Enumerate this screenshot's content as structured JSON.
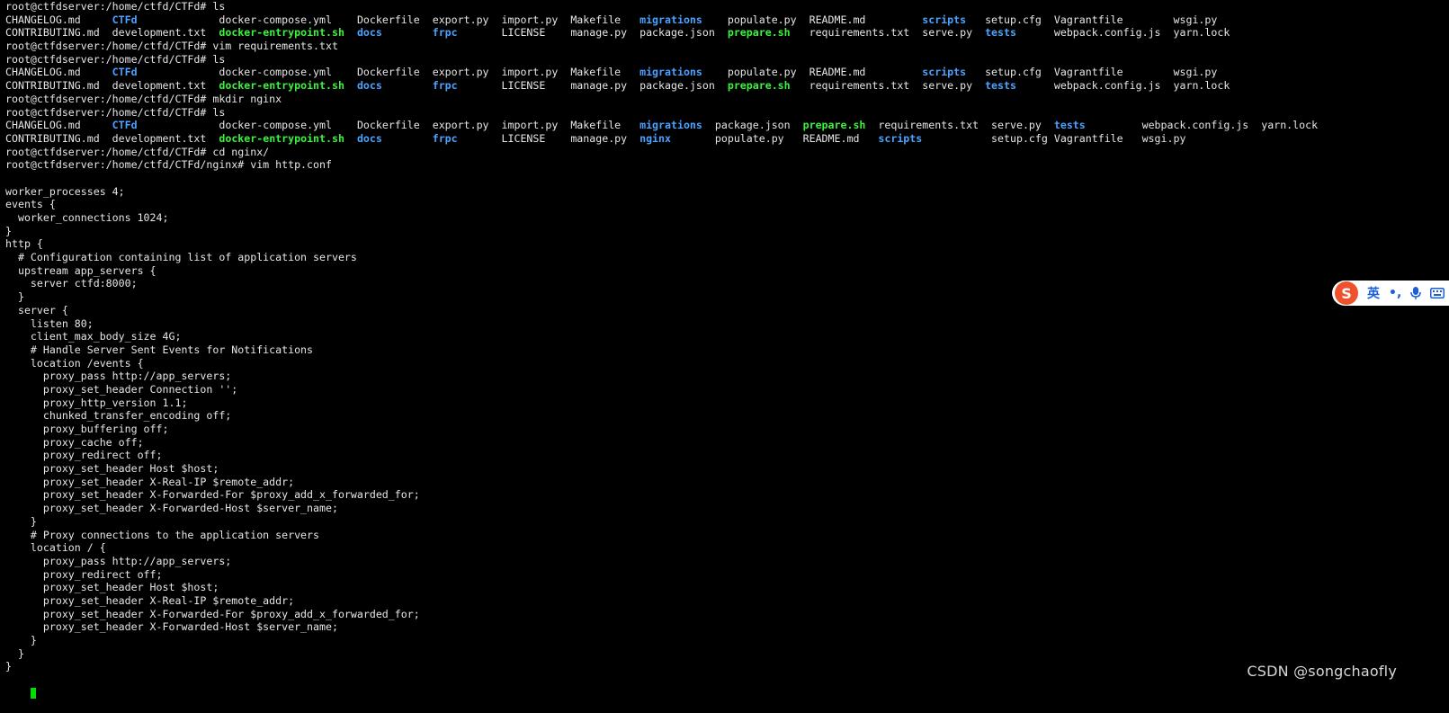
{
  "lines": [
    {
      "cells": [
        {
          "text": "root@ctfdserver:/home/ctfd/CTFd# ls",
          "col": 0,
          "type": "plain"
        }
      ]
    },
    {
      "cells": [
        {
          "text": "CHANGELOG.md",
          "col": 0,
          "type": "plain"
        },
        {
          "text": "CTFd",
          "col": 17,
          "type": "dir"
        },
        {
          "text": "docker-compose.yml",
          "col": 34,
          "type": "plain"
        },
        {
          "text": "Dockerfile",
          "col": 56,
          "type": "plain"
        },
        {
          "text": "export.py",
          "col": 68,
          "type": "plain"
        },
        {
          "text": "import.py",
          "col": 79,
          "type": "plain"
        },
        {
          "text": "Makefile",
          "col": 90,
          "type": "plain"
        },
        {
          "text": "migrations",
          "col": 101,
          "type": "dir"
        },
        {
          "text": "populate.py",
          "col": 115,
          "type": "plain"
        },
        {
          "text": "README.md",
          "col": 128,
          "type": "plain"
        },
        {
          "text": "scripts",
          "col": 146,
          "type": "dir"
        },
        {
          "text": "setup.cfg",
          "col": 156,
          "type": "plain"
        },
        {
          "text": "Vagrantfile",
          "col": 167,
          "type": "plain"
        },
        {
          "text": "wsgi.py",
          "col": 186,
          "type": "plain"
        }
      ]
    },
    {
      "cells": [
        {
          "text": "CONTRIBUTING.md",
          "col": 0,
          "type": "plain"
        },
        {
          "text": "development.txt",
          "col": 17,
          "type": "plain"
        },
        {
          "text": "docker-entrypoint.sh",
          "col": 34,
          "type": "exec"
        },
        {
          "text": "docs",
          "col": 56,
          "type": "dir"
        },
        {
          "text": "frpc",
          "col": 68,
          "type": "dir"
        },
        {
          "text": "LICENSE",
          "col": 79,
          "type": "plain"
        },
        {
          "text": "manage.py",
          "col": 90,
          "type": "plain"
        },
        {
          "text": "package.json",
          "col": 101,
          "type": "plain"
        },
        {
          "text": "prepare.sh",
          "col": 115,
          "type": "exec"
        },
        {
          "text": "requirements.txt",
          "col": 128,
          "type": "plain"
        },
        {
          "text": "serve.py",
          "col": 146,
          "type": "plain"
        },
        {
          "text": "tests",
          "col": 156,
          "type": "dir"
        },
        {
          "text": "webpack.config.js",
          "col": 167,
          "type": "plain"
        },
        {
          "text": "yarn.lock",
          "col": 186,
          "type": "plain"
        }
      ]
    },
    {
      "cells": [
        {
          "text": "root@ctfdserver:/home/ctfd/CTFd# vim requirements.txt",
          "col": 0,
          "type": "plain"
        }
      ]
    },
    {
      "cells": [
        {
          "text": "root@ctfdserver:/home/ctfd/CTFd# ls",
          "col": 0,
          "type": "plain"
        }
      ]
    },
    {
      "cells": [
        {
          "text": "CHANGELOG.md",
          "col": 0,
          "type": "plain"
        },
        {
          "text": "CTFd",
          "col": 17,
          "type": "dir"
        },
        {
          "text": "docker-compose.yml",
          "col": 34,
          "type": "plain"
        },
        {
          "text": "Dockerfile",
          "col": 56,
          "type": "plain"
        },
        {
          "text": "export.py",
          "col": 68,
          "type": "plain"
        },
        {
          "text": "import.py",
          "col": 79,
          "type": "plain"
        },
        {
          "text": "Makefile",
          "col": 90,
          "type": "plain"
        },
        {
          "text": "migrations",
          "col": 101,
          "type": "dir"
        },
        {
          "text": "populate.py",
          "col": 115,
          "type": "plain"
        },
        {
          "text": "README.md",
          "col": 128,
          "type": "plain"
        },
        {
          "text": "scripts",
          "col": 146,
          "type": "dir"
        },
        {
          "text": "setup.cfg",
          "col": 156,
          "type": "plain"
        },
        {
          "text": "Vagrantfile",
          "col": 167,
          "type": "plain"
        },
        {
          "text": "wsgi.py",
          "col": 186,
          "type": "plain"
        }
      ]
    },
    {
      "cells": [
        {
          "text": "CONTRIBUTING.md",
          "col": 0,
          "type": "plain"
        },
        {
          "text": "development.txt",
          "col": 17,
          "type": "plain"
        },
        {
          "text": "docker-entrypoint.sh",
          "col": 34,
          "type": "exec"
        },
        {
          "text": "docs",
          "col": 56,
          "type": "dir"
        },
        {
          "text": "frpc",
          "col": 68,
          "type": "dir"
        },
        {
          "text": "LICENSE",
          "col": 79,
          "type": "plain"
        },
        {
          "text": "manage.py",
          "col": 90,
          "type": "plain"
        },
        {
          "text": "package.json",
          "col": 101,
          "type": "plain"
        },
        {
          "text": "prepare.sh",
          "col": 115,
          "type": "exec"
        },
        {
          "text": "requirements.txt",
          "col": 128,
          "type": "plain"
        },
        {
          "text": "serve.py",
          "col": 146,
          "type": "plain"
        },
        {
          "text": "tests",
          "col": 156,
          "type": "dir"
        },
        {
          "text": "webpack.config.js",
          "col": 167,
          "type": "plain"
        },
        {
          "text": "yarn.lock",
          "col": 186,
          "type": "plain"
        }
      ]
    },
    {
      "cells": [
        {
          "text": "root@ctfdserver:/home/ctfd/CTFd# mkdir nginx",
          "col": 0,
          "type": "plain"
        }
      ]
    },
    {
      "cells": [
        {
          "text": "root@ctfdserver:/home/ctfd/CTFd# ls",
          "col": 0,
          "type": "plain"
        }
      ]
    },
    {
      "cells": [
        {
          "text": "CHANGELOG.md",
          "col": 0,
          "type": "plain"
        },
        {
          "text": "CTFd",
          "col": 17,
          "type": "dir"
        },
        {
          "text": "docker-compose.yml",
          "col": 34,
          "type": "plain"
        },
        {
          "text": "Dockerfile",
          "col": 56,
          "type": "plain"
        },
        {
          "text": "export.py",
          "col": 68,
          "type": "plain"
        },
        {
          "text": "import.py",
          "col": 79,
          "type": "plain"
        },
        {
          "text": "Makefile",
          "col": 90,
          "type": "plain"
        },
        {
          "text": "migrations",
          "col": 101,
          "type": "dir"
        },
        {
          "text": "package.json",
          "col": 113,
          "type": "plain"
        },
        {
          "text": "prepare.sh",
          "col": 127,
          "type": "exec"
        },
        {
          "text": "requirements.txt",
          "col": 139,
          "type": "plain"
        },
        {
          "text": "serve.py",
          "col": 157,
          "type": "plain"
        },
        {
          "text": "tests",
          "col": 167,
          "type": "dir"
        },
        {
          "text": "webpack.config.js",
          "col": 181,
          "type": "plain"
        },
        {
          "text": "yarn.lock",
          "col": 200,
          "type": "plain"
        }
      ]
    },
    {
      "cells": [
        {
          "text": "CONTRIBUTING.md",
          "col": 0,
          "type": "plain"
        },
        {
          "text": "development.txt",
          "col": 17,
          "type": "plain"
        },
        {
          "text": "docker-entrypoint.sh",
          "col": 34,
          "type": "exec"
        },
        {
          "text": "docs",
          "col": 56,
          "type": "dir"
        },
        {
          "text": "frpc",
          "col": 68,
          "type": "dir"
        },
        {
          "text": "LICENSE",
          "col": 79,
          "type": "plain"
        },
        {
          "text": "manage.py",
          "col": 90,
          "type": "plain"
        },
        {
          "text": "nginx",
          "col": 101,
          "type": "dir"
        },
        {
          "text": "populate.py",
          "col": 113,
          "type": "plain"
        },
        {
          "text": "README.md",
          "col": 127,
          "type": "plain"
        },
        {
          "text": "scripts",
          "col": 139,
          "type": "dir"
        },
        {
          "text": "setup.cfg",
          "col": 157,
          "type": "plain"
        },
        {
          "text": "Vagrantfile",
          "col": 167,
          "type": "plain"
        },
        {
          "text": "wsgi.py",
          "col": 181,
          "type": "plain"
        }
      ]
    },
    {
      "cells": [
        {
          "text": "root@ctfdserver:/home/ctfd/CTFd# cd nginx/",
          "col": 0,
          "type": "plain"
        }
      ]
    },
    {
      "cells": [
        {
          "text": "root@ctfdserver:/home/ctfd/CTFd/nginx# vim http.conf",
          "col": 0,
          "type": "plain"
        }
      ]
    },
    {
      "cells": [
        {
          "text": "",
          "col": 0,
          "type": "plain"
        }
      ]
    },
    {
      "cells": [
        {
          "text": "worker_processes 4;",
          "col": 0,
          "type": "plain"
        }
      ]
    },
    {
      "cells": [
        {
          "text": "events {",
          "col": 0,
          "type": "plain"
        }
      ]
    },
    {
      "cells": [
        {
          "text": "  worker_connections 1024;",
          "col": 0,
          "type": "plain"
        }
      ]
    },
    {
      "cells": [
        {
          "text": "}",
          "col": 0,
          "type": "plain"
        }
      ]
    },
    {
      "cells": [
        {
          "text": "http {",
          "col": 0,
          "type": "plain"
        }
      ]
    },
    {
      "cells": [
        {
          "text": "  # Configuration containing list of application servers",
          "col": 0,
          "type": "plain"
        }
      ]
    },
    {
      "cells": [
        {
          "text": "  upstream app_servers {",
          "col": 0,
          "type": "plain"
        }
      ]
    },
    {
      "cells": [
        {
          "text": "    server ctfd:8000;",
          "col": 0,
          "type": "plain"
        }
      ]
    },
    {
      "cells": [
        {
          "text": "  }",
          "col": 0,
          "type": "plain"
        }
      ]
    },
    {
      "cells": [
        {
          "text": "  server {",
          "col": 0,
          "type": "plain"
        }
      ]
    },
    {
      "cells": [
        {
          "text": "    listen 80;",
          "col": 0,
          "type": "plain"
        }
      ]
    },
    {
      "cells": [
        {
          "text": "    client_max_body_size 4G;",
          "col": 0,
          "type": "plain"
        }
      ]
    },
    {
      "cells": [
        {
          "text": "    # Handle Server Sent Events for Notifications",
          "col": 0,
          "type": "plain"
        }
      ]
    },
    {
      "cells": [
        {
          "text": "    location /events {",
          "col": 0,
          "type": "plain"
        }
      ]
    },
    {
      "cells": [
        {
          "text": "      proxy_pass http://app_servers;",
          "col": 0,
          "type": "plain"
        }
      ]
    },
    {
      "cells": [
        {
          "text": "      proxy_set_header Connection '';",
          "col": 0,
          "type": "plain"
        }
      ]
    },
    {
      "cells": [
        {
          "text": "      proxy_http_version 1.1;",
          "col": 0,
          "type": "plain"
        }
      ]
    },
    {
      "cells": [
        {
          "text": "      chunked_transfer_encoding off;",
          "col": 0,
          "type": "plain"
        }
      ]
    },
    {
      "cells": [
        {
          "text": "      proxy_buffering off;",
          "col": 0,
          "type": "plain"
        }
      ]
    },
    {
      "cells": [
        {
          "text": "      proxy_cache off;",
          "col": 0,
          "type": "plain"
        }
      ]
    },
    {
      "cells": [
        {
          "text": "      proxy_redirect off;",
          "col": 0,
          "type": "plain"
        }
      ]
    },
    {
      "cells": [
        {
          "text": "      proxy_set_header Host $host;",
          "col": 0,
          "type": "plain"
        }
      ]
    },
    {
      "cells": [
        {
          "text": "      proxy_set_header X-Real-IP $remote_addr;",
          "col": 0,
          "type": "plain"
        }
      ]
    },
    {
      "cells": [
        {
          "text": "      proxy_set_header X-Forwarded-For $proxy_add_x_forwarded_for;",
          "col": 0,
          "type": "plain"
        }
      ]
    },
    {
      "cells": [
        {
          "text": "      proxy_set_header X-Forwarded-Host $server_name;",
          "col": 0,
          "type": "plain"
        }
      ]
    },
    {
      "cells": [
        {
          "text": "    }",
          "col": 0,
          "type": "plain"
        }
      ]
    },
    {
      "cells": [
        {
          "text": "    # Proxy connections to the application servers",
          "col": 0,
          "type": "plain"
        }
      ]
    },
    {
      "cells": [
        {
          "text": "    location / {",
          "col": 0,
          "type": "plain"
        }
      ]
    },
    {
      "cells": [
        {
          "text": "      proxy_pass http://app_servers;",
          "col": 0,
          "type": "plain"
        }
      ]
    },
    {
      "cells": [
        {
          "text": "      proxy_redirect off;",
          "col": 0,
          "type": "plain"
        }
      ]
    },
    {
      "cells": [
        {
          "text": "      proxy_set_header Host $host;",
          "col": 0,
          "type": "plain"
        }
      ]
    },
    {
      "cells": [
        {
          "text": "      proxy_set_header X-Real-IP $remote_addr;",
          "col": 0,
          "type": "plain"
        }
      ]
    },
    {
      "cells": [
        {
          "text": "      proxy_set_header X-Forwarded-For $proxy_add_x_forwarded_for;",
          "col": 0,
          "type": "plain"
        }
      ]
    },
    {
      "cells": [
        {
          "text": "      proxy_set_header X-Forwarded-Host $server_name;",
          "col": 0,
          "type": "plain"
        }
      ]
    },
    {
      "cells": [
        {
          "text": "    }",
          "col": 0,
          "type": "plain"
        }
      ]
    },
    {
      "cells": [
        {
          "text": "  }",
          "col": 0,
          "type": "plain"
        }
      ]
    },
    {
      "cells": [
        {
          "text": "}",
          "col": 0,
          "type": "plain"
        }
      ]
    }
  ],
  "cursor": {
    "color": "#00e000"
  },
  "colors": {
    "background": "#000000",
    "text": "#e6e6e6",
    "directory": "#4aa3ff",
    "executable": "#3cf23c"
  },
  "ime": {
    "logo": "S",
    "mode_label": "英",
    "punct": "•,",
    "icons": [
      "sogou-logo-icon",
      "microphone-icon",
      "keyboard-icon"
    ]
  },
  "watermark": "CSDN @songchaofly"
}
